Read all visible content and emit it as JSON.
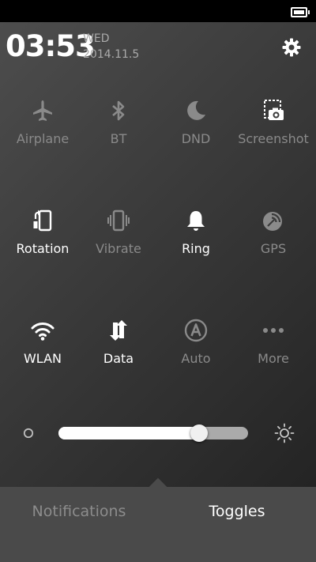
{
  "header": {
    "time": "03:53",
    "day": "WED",
    "date": "2014.11.5"
  },
  "toggles": [
    {
      "label": "Airplane",
      "icon": "airplane-icon",
      "on": false
    },
    {
      "label": "BT",
      "icon": "bluetooth-icon",
      "on": false
    },
    {
      "label": "DND",
      "icon": "moon-icon",
      "on": false
    },
    {
      "label": "Screenshot",
      "icon": "screenshot-icon",
      "on": false
    },
    {
      "label": "Rotation",
      "icon": "rotation-icon",
      "on": true
    },
    {
      "label": "Vibrate",
      "icon": "vibrate-icon",
      "on": false
    },
    {
      "label": "Ring",
      "icon": "bell-icon",
      "on": true
    },
    {
      "label": "GPS",
      "icon": "gps-icon",
      "on": false
    },
    {
      "label": "WLAN",
      "icon": "wifi-icon",
      "on": true
    },
    {
      "label": "Data",
      "icon": "data-arrows-icon",
      "on": true
    },
    {
      "label": "Auto",
      "icon": "auto-brightness-icon",
      "on": false
    },
    {
      "label": "More",
      "icon": "more-icon",
      "on": false
    }
  ],
  "brightness": {
    "level": 0.74
  },
  "tabs": [
    {
      "label": "Notifications",
      "active": false
    },
    {
      "label": "Toggles",
      "active": true
    }
  ],
  "colors": {
    "on": "#ffffff",
    "off": "#8a8a8a",
    "panel": "#3c3c3c",
    "tabbar": "#4a4a4a"
  }
}
